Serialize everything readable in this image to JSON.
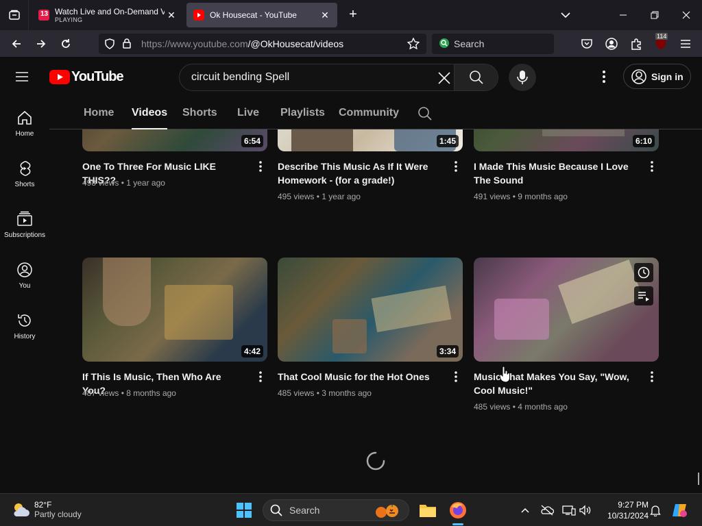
{
  "browser": {
    "tabs": [
      {
        "title": "Watch Live and On-Demand Vi",
        "subtitle": "PLAYING",
        "active": false,
        "favicon_color": "#e11d48"
      },
      {
        "title": "Ok Housecat - YouTube",
        "active": true,
        "favicon_color": "#ff0000"
      }
    ],
    "url_host": "https://www.youtube.com",
    "url_path": "/@OkHousecat/videos",
    "search_placeholder": "Search",
    "ext_badge": "114"
  },
  "youtube": {
    "logo_text": "YouTube",
    "search_query": "circuit bending Spell",
    "sign_in_label": "Sign in",
    "sidebar": [
      {
        "label": "Home",
        "icon": "home-icon"
      },
      {
        "label": "Shorts",
        "icon": "shorts-icon"
      },
      {
        "label": "Subscriptions",
        "icon": "subscriptions-icon"
      },
      {
        "label": "You",
        "icon": "you-icon"
      },
      {
        "label": "History",
        "icon": "history-icon"
      }
    ],
    "channel_tabs": [
      "Home",
      "Videos",
      "Shorts",
      "Live",
      "Playlists",
      "Community"
    ],
    "active_tab": "Videos",
    "videos": [
      {
        "title": "One To Three For Music LIKE THIS??",
        "views": "498 views",
        "age": "1 year ago",
        "duration": "6:54"
      },
      {
        "title": "Describe This Music As If It Were Homework - (for a grade!)",
        "views": "495 views",
        "age": "1 year ago",
        "duration": "1:45"
      },
      {
        "title": "I Made This Music Because I Love The Sound",
        "views": "491 views",
        "age": "9 months ago",
        "duration": "6:10"
      },
      {
        "title": "If This Is Music, Then Who Are You?",
        "views": "487 views",
        "age": "8 months ago",
        "duration": "4:42"
      },
      {
        "title": "That Cool Music for the Hot Ones",
        "views": "485 views",
        "age": "3 months ago",
        "duration": "3:34"
      },
      {
        "title": "Music That Makes You Say, \"Wow, Cool Music!\"",
        "views": "485 views",
        "age": "4 months ago",
        "duration": ""
      }
    ]
  },
  "taskbar": {
    "temp": "82°F",
    "weather": "Partly cloudy",
    "search_label": "Search",
    "time": "9:27 PM",
    "date": "10/31/2024"
  }
}
